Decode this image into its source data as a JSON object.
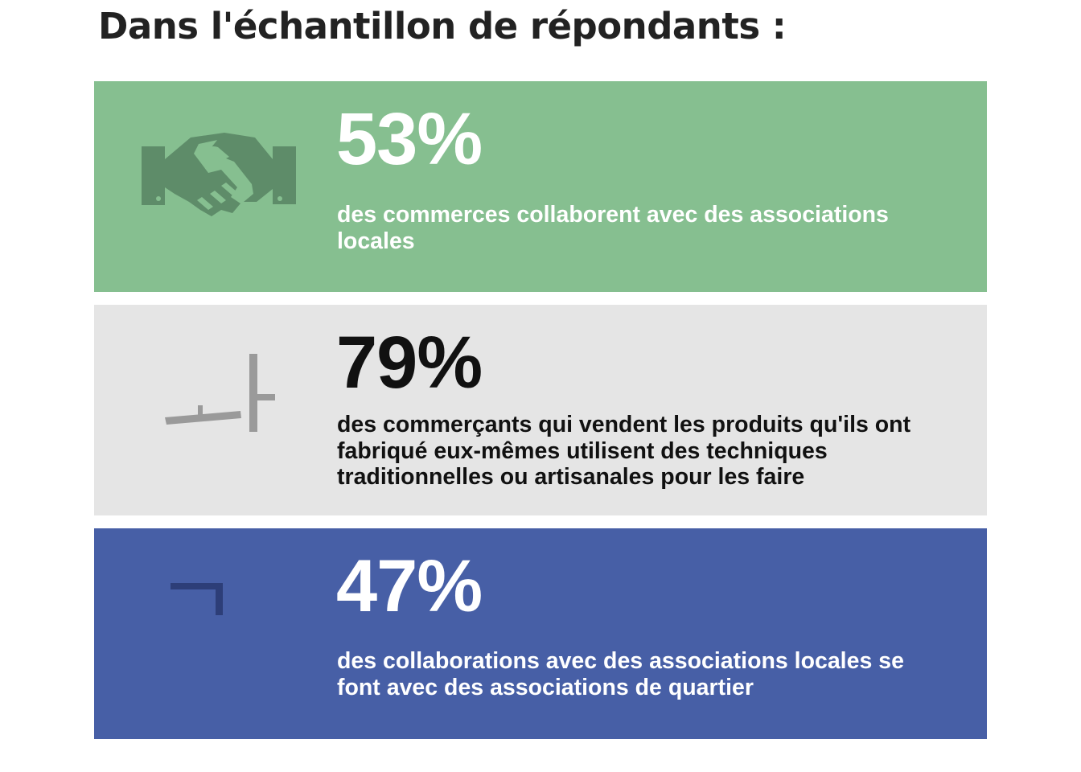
{
  "title": "Dans l'échantillon de répondants :",
  "cards": [
    {
      "value": "53%",
      "description": "des commerces collaborent avec des associations locales",
      "icon": "handshake-icon",
      "background": "#86bf90"
    },
    {
      "value": "79%",
      "description": "des commerçants qui vendent les produits qu'ils ont fabriqué eux-mêmes utilisent des techniques traditionnelles ou artisanales pour les faire",
      "icon": "tools-icon",
      "background": "#e5e5e5"
    },
    {
      "value": "47%",
      "description": "des collaborations avec des associations locales se font avec des associations de quartier",
      "icon": "neighborhood-icon",
      "background": "#475fa6"
    }
  ]
}
